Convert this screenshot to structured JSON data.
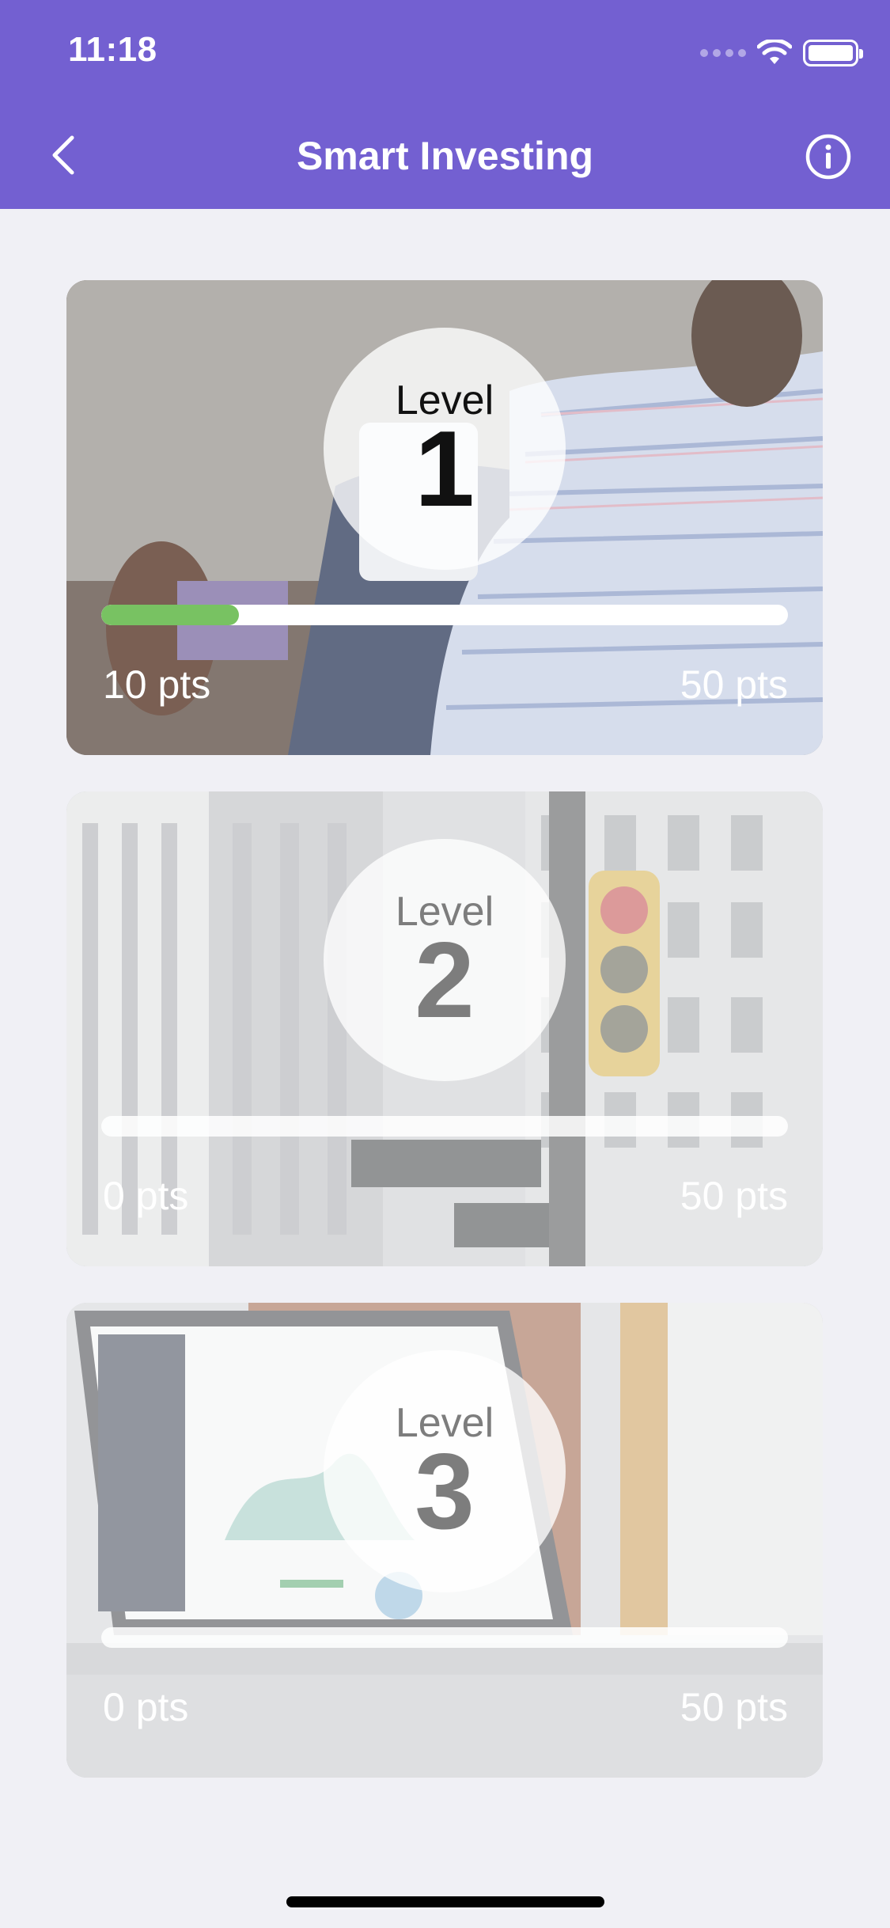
{
  "status_bar": {
    "time": "11:18"
  },
  "nav": {
    "title": "Smart Investing",
    "back_icon": "chevron-left-icon",
    "info_icon": "info-circle-icon"
  },
  "colors": {
    "header": "#7360d1",
    "progress_fill": "#78c262",
    "background": "#f0f0f5"
  },
  "levels": [
    {
      "label": "Level",
      "number": "1",
      "points_current": "10 pts",
      "points_total": "50 pts",
      "progress": 0.2,
      "image": "business-man-tablet-photo"
    },
    {
      "label": "Level",
      "number": "2",
      "points_current": "0 pts",
      "points_total": "50 pts",
      "progress": 0,
      "image": "wall-street-sign-photo"
    },
    {
      "label": "Level",
      "number": "3",
      "points_current": "0 pts",
      "points_total": "50 pts",
      "progress": 0,
      "image": "laptop-dashboard-photo"
    }
  ]
}
